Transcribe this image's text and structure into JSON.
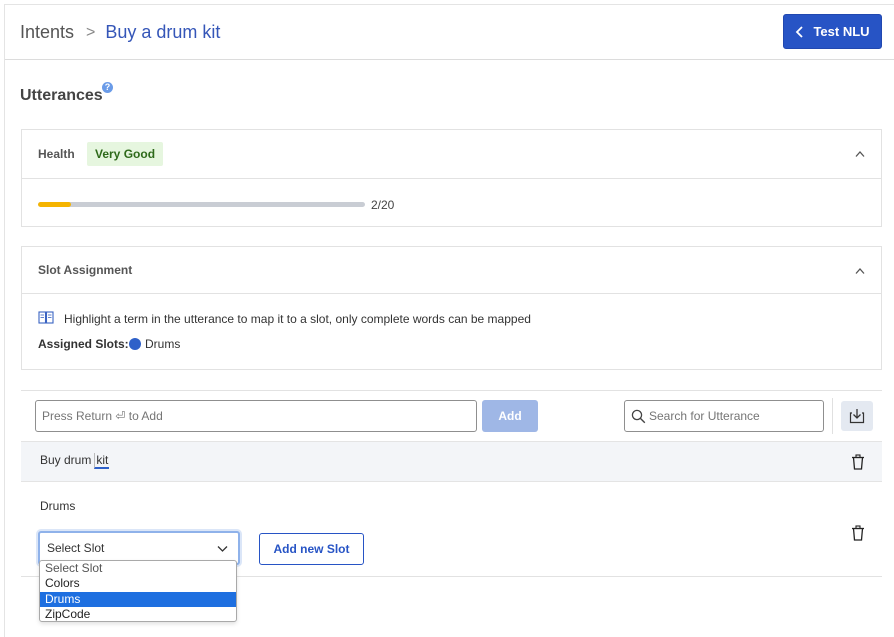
{
  "breadcrumb": {
    "root": "Intents",
    "separator": ">",
    "current": "Buy a drum kit"
  },
  "header": {
    "test_button_label": "Test NLU"
  },
  "section": {
    "title": "Utterances",
    "help_glyph": "?"
  },
  "health": {
    "label": "Health",
    "badge": "Very Good",
    "progress_text": "2/20",
    "progress_fraction": 0.1,
    "fill_color": "#f5b400"
  },
  "slot_assignment": {
    "title": "Slot Assignment",
    "info_text": "Highlight a term in the utterance to map it to a slot, only complete words can be mapped",
    "assigned_label": "Assigned Slots:",
    "assigned_slot": "Drums",
    "slot_color": "#2f61c9"
  },
  "utterance_toolbar": {
    "add_placeholder": "Press Return ⏎ to Add",
    "add_button": "Add",
    "search_placeholder": "Search for Utterance"
  },
  "utterance": {
    "text_prefix": "Buy drum",
    "highlighted": "kit"
  },
  "slot_row": {
    "label": "Drums",
    "select_value": "Select Slot",
    "add_slot_button": "Add new Slot"
  },
  "slot_options": [
    "Select Slot",
    "Colors",
    "Drums",
    "ZipCode"
  ],
  "selected_option": "Drums",
  "icons": {
    "help": "help-icon",
    "chevron": "chevron-up-icon",
    "book": "book-icon",
    "search": "search-icon",
    "import": "import-icon",
    "trash": "trash-icon"
  }
}
